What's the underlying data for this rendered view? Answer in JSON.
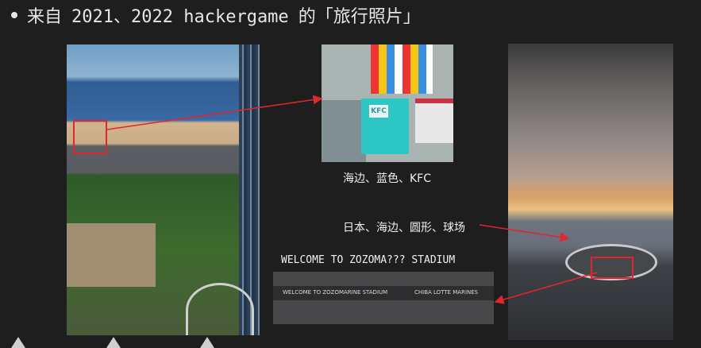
{
  "bullet": {
    "prefix": "来自",
    "years": "2021、2022 hackergame",
    "suffix": "的「旅行照片」"
  },
  "photos": {
    "kfc_sign": "KFC",
    "stadium_sign_1": "WELCOME TO ZOZOMARINE STADIUM",
    "stadium_sign_2": "CHIBA LOTTE MARINES"
  },
  "captions": {
    "kfc": "海边、蓝色、KFC",
    "stadium": "日本、海边、圆形、球场",
    "welcome": "WELCOME TO ZOZOMA??? STADIUM"
  },
  "colors": {
    "background": "#1e1e1e",
    "annotation_red": "#e0262e",
    "text": "#f0f0f0"
  }
}
